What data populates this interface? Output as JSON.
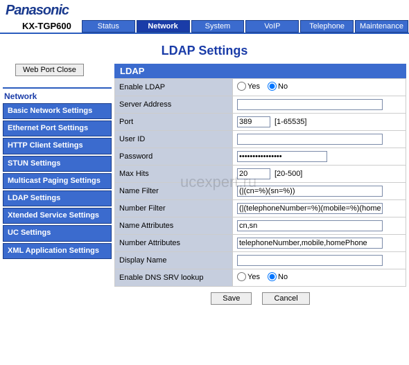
{
  "brand": "Panasonic",
  "model": "KX-TGP600",
  "watermark": "ucexpert.ru",
  "topnav": [
    {
      "label": "Status",
      "active": false
    },
    {
      "label": "Network",
      "active": true
    },
    {
      "label": "System",
      "active": false
    },
    {
      "label": "VoIP",
      "active": false
    },
    {
      "label": "Telephone",
      "active": false
    },
    {
      "label": "Maintenance",
      "active": false
    }
  ],
  "page_title": "LDAP Settings",
  "web_port_btn": "Web Port Close",
  "side_title": "Network",
  "sidemenu": [
    "Basic Network Settings",
    "Ethernet Port Settings",
    "HTTP Client Settings",
    "STUN Settings",
    "Multicast Paging Settings",
    "LDAP Settings",
    "Xtended Service Settings",
    "UC Settings",
    "XML Application Settings"
  ],
  "section_title": "LDAP",
  "yes": "Yes",
  "no": "No",
  "fields": {
    "enable_ldap": {
      "label": "Enable LDAP",
      "value": "No"
    },
    "server_address": {
      "label": "Server Address",
      "value": ""
    },
    "port": {
      "label": "Port",
      "value": "389",
      "hint": "[1-65535]"
    },
    "user_id": {
      "label": "User ID",
      "value": ""
    },
    "password": {
      "label": "Password",
      "value": "••••••••••••••••"
    },
    "max_hits": {
      "label": "Max Hits",
      "value": "20",
      "hint": "[20-500]"
    },
    "name_filter": {
      "label": "Name Filter",
      "value": "(|(cn=%)(sn=%))"
    },
    "number_filter": {
      "label": "Number Filter",
      "value": "(|(telephoneNumber=%)(mobile=%)(homePhone=%"
    },
    "name_attributes": {
      "label": "Name Attributes",
      "value": "cn,sn"
    },
    "number_attributes": {
      "label": "Number Attributes",
      "value": "telephoneNumber,mobile,homePhone"
    },
    "display_name": {
      "label": "Display Name",
      "value": ""
    },
    "enable_dns": {
      "label": "Enable DNS SRV lookup",
      "value": "No"
    }
  },
  "buttons": {
    "save": "Save",
    "cancel": "Cancel"
  }
}
